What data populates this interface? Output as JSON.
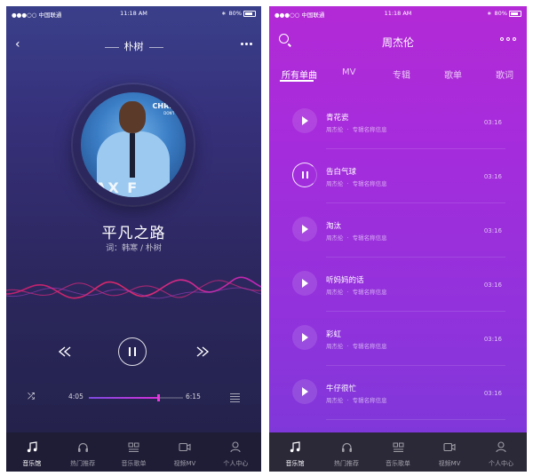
{
  "status": {
    "carrier": "●●●○○ 中国联通",
    "time": "11:18 AM",
    "battery": "80%"
  },
  "player": {
    "title": "朴树",
    "song_title": "平凡之路",
    "credit": "词：韩寒 / 朴树",
    "album_text": "CHRIS",
    "album_sub": "DON'T",
    "album_word": "ΔX F",
    "current_time": "4:05",
    "total_time": "6:15",
    "progress": 0.74
  },
  "list": {
    "title": "周杰伦",
    "categories": [
      "所有单曲",
      "MV",
      "专辑",
      "歌单",
      "歌词"
    ],
    "active_category": 0,
    "songs": [
      {
        "name": "青花瓷",
        "artist": "周杰伦",
        "album": "专辑名称信息",
        "duration": "03:16",
        "playing": false
      },
      {
        "name": "告白气球",
        "artist": "周杰伦",
        "album": "专辑名称信息",
        "duration": "03:16",
        "playing": true
      },
      {
        "name": "淘汰",
        "artist": "周杰伦",
        "album": "专辑名称信息",
        "duration": "03:16",
        "playing": false
      },
      {
        "name": "听妈妈的话",
        "artist": "周杰伦",
        "album": "专辑名称信息",
        "duration": "03:16",
        "playing": false
      },
      {
        "name": "彩虹",
        "artist": "周杰伦",
        "album": "专辑名称信息",
        "duration": "03:16",
        "playing": false
      },
      {
        "name": "牛仔很忙",
        "artist": "周杰伦",
        "album": "专辑名称信息",
        "duration": "03:16",
        "playing": false
      }
    ]
  },
  "tabs": [
    {
      "label": "音乐馆",
      "icon": "music-note-icon",
      "active": true
    },
    {
      "label": "热门推荐",
      "icon": "headphones-icon",
      "active": false
    },
    {
      "label": "音乐歌单",
      "icon": "playlist-grid-icon",
      "active": false
    },
    {
      "label": "视频MV",
      "icon": "video-camera-icon",
      "active": false
    },
    {
      "label": "个人中心",
      "icon": "user-icon",
      "active": false
    }
  ],
  "colors": {
    "left_bg": "#2d2860",
    "right_bg": "#a52cdc",
    "accent": "#e43ad8",
    "tabbar": "#1f1d36"
  }
}
